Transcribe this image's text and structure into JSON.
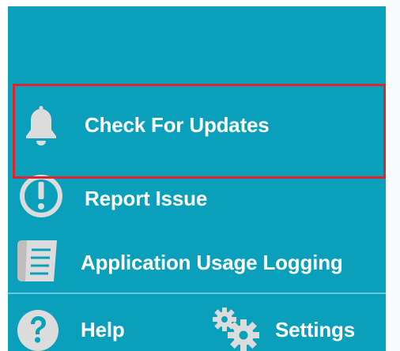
{
  "menu": {
    "items": [
      {
        "label": "Check For Updates",
        "icon": "bell-icon"
      },
      {
        "label": "Report Issue",
        "icon": "exclamation-circle-icon"
      },
      {
        "label": "Application Usage Logging",
        "icon": "log-document-icon"
      }
    ]
  },
  "footer": {
    "help_label": "Help",
    "help_icon": "question-circle-icon",
    "settings_label": "Settings",
    "settings_icon": "gears-icon"
  },
  "colors": {
    "panel": "#0aa0bb",
    "icon": "#dcdcdc",
    "highlight_border": "#e0242b",
    "text": "#ffffff"
  }
}
